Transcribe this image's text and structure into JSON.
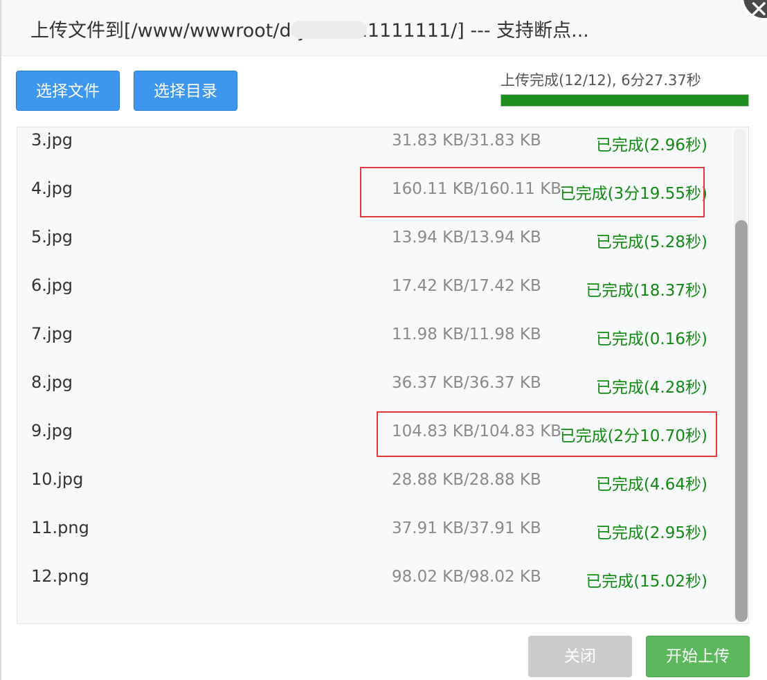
{
  "dialog": {
    "title": "上传文件到[/www/wwwroot/d  y    ab/111111111/] --- 支持断点...",
    "close_icon": "close-icon"
  },
  "toolbar": {
    "select_file_label": "选择文件",
    "select_dir_label": "选择目录"
  },
  "progress": {
    "label": "上传完成(12/12), 6分27.37秒",
    "fraction": 1.0,
    "color": "#1e8f1e"
  },
  "files": [
    {
      "name": "3.jpg",
      "size": "31.83 KB/31.83 KB",
      "status": "已完成(2.96秒)"
    },
    {
      "name": "4.jpg",
      "size": "160.11 KB/160.11 KB",
      "status": "已完成(3分19.55秒)"
    },
    {
      "name": "5.jpg",
      "size": "13.94 KB/13.94 KB",
      "status": "已完成(5.28秒)"
    },
    {
      "name": "6.jpg",
      "size": "17.42 KB/17.42 KB",
      "status": "已完成(18.37秒)"
    },
    {
      "name": "7.jpg",
      "size": "11.98 KB/11.98 KB",
      "status": "已完成(0.16秒)"
    },
    {
      "name": "8.jpg",
      "size": "36.37 KB/36.37 KB",
      "status": "已完成(4.28秒)"
    },
    {
      "name": "9.jpg",
      "size": "104.83 KB/104.83 KB",
      "status": "已完成(2分10.70秒)"
    },
    {
      "name": "10.jpg",
      "size": "28.88 KB/28.88 KB",
      "status": "已完成(4.64秒)"
    },
    {
      "name": "11.png",
      "size": "37.91 KB/37.91 KB",
      "status": "已完成(2.95秒)"
    },
    {
      "name": "12.png",
      "size": "98.02 KB/98.02 KB",
      "status": "已完成(15.02秒)"
    }
  ],
  "footer": {
    "close_label": "关闭",
    "start_label": "开始上传"
  },
  "colors": {
    "primary": "#3d97ef",
    "success": "#5cb85c",
    "status_done": "#108a10",
    "highlight": "#e03a3a"
  }
}
